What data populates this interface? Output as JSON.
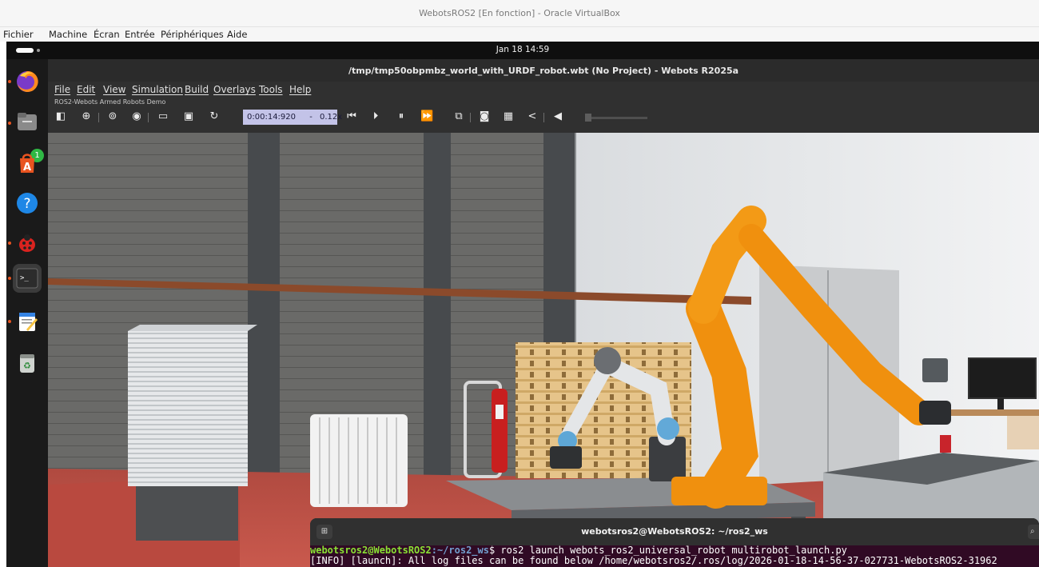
{
  "host_window": {
    "title": "WebotsROS2 [En fonction] - Oracle VirtualBox",
    "menu": [
      "Fichier",
      "Machine",
      "Écran",
      "Entrée",
      "Périphériques",
      "Aide"
    ]
  },
  "ubuntu": {
    "clock": "Jan 18  14:59",
    "dock": {
      "items": [
        {
          "name": "Firefox",
          "icon": "firefox-icon"
        },
        {
          "name": "Files",
          "icon": "files-icon",
          "badge": "1"
        },
        {
          "name": "App Center",
          "icon": "app-center-icon"
        },
        {
          "name": "Help",
          "icon": "help-icon"
        },
        {
          "name": "Webots",
          "icon": "webots-ladybug-icon"
        },
        {
          "name": "Terminal",
          "icon": "terminal-icon"
        },
        {
          "name": "Text Editor",
          "icon": "text-editor-icon"
        },
        {
          "name": "Trash",
          "icon": "trash-icon"
        }
      ]
    }
  },
  "webots": {
    "title": "/tmp/tmp50obpmbz_world_with_URDF_robot.wbt (No Project) - Webots R2025a",
    "menu": [
      "File",
      "Edit",
      "View",
      "Simulation",
      "Build",
      "Overlays",
      "Tools",
      "Help"
    ],
    "world_info": "ROS2-Webots Armed Robots Demo",
    "toolbar": {
      "time": "0:00:14:920",
      "speed_separator": "-",
      "speed": "0.12x"
    }
  },
  "terminal": {
    "title": "webotsros2@WebotsROS2: ~/ros2_ws",
    "prompt_user": "webotsros2@WebotsROS2",
    "prompt_path": ":~/ros2_ws",
    "command": "$ ros2 launch webots_ros2_universal_robot multirobot_launch.py",
    "output_line": "[INFO] [launch]: All log files can be found below /home/webotsros2/.ros/log/2026-01-18-14-56-37-027731-WebotsROS2-31962"
  },
  "colors": {
    "ubuntu_orange": "#e95420",
    "robot_orange": "#f0900e",
    "terminal_bg": "#300a24",
    "time_box": "#c3c3e8",
    "floor_red": "#b8483e"
  }
}
